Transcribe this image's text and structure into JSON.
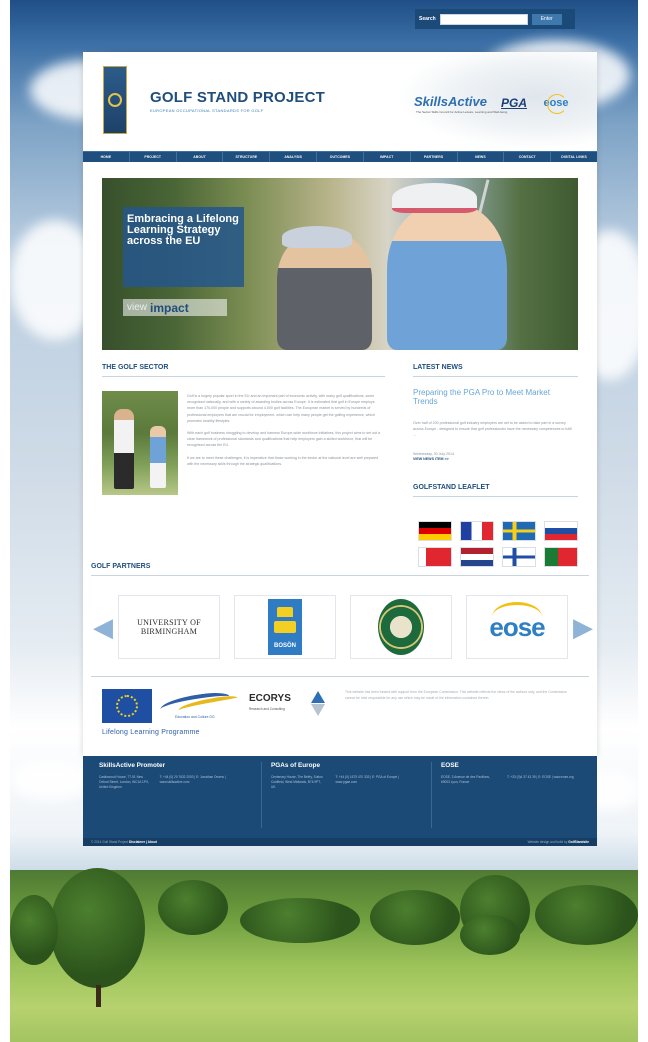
{
  "search": {
    "label": "Search",
    "placeholder": "",
    "button": "Enter"
  },
  "header": {
    "title": "GOLF STAND PROJECT",
    "subtitle": "EUROPEAN OCCUPATIONAL STANDARDS FOR GOLF",
    "logos": {
      "skillsactive": "SkillsActive",
      "skillsactive_sub": "The Sector Skills Council for Active Leisure, Learning and Well-being",
      "pga": "PGA",
      "eose": "eose"
    }
  },
  "nav": [
    "HOME",
    "PROJECT",
    "ABOUT",
    "STRUCTURE",
    "ANALYSIS",
    "OUTCOMES",
    "IMPACT",
    "PARTNERS",
    "NEWS",
    "CONTACT",
    "DIGITAL LINKS"
  ],
  "hero": {
    "caption_line1": "Embracing a Lifelong",
    "caption_line2": "Learning Strategy",
    "caption_line3": "across the EU",
    "button_view": "view",
    "button_impact": "impact"
  },
  "golf_sector": {
    "title": "THE GOLF SECTOR",
    "paragraphs": [
      "Golf is a hugely popular sport in the EU and an important part of economic activity, with many golf qualifications, some recognised nationally, and with a variety of awarding bodies across Europe. It is estimated that golf in Europe employs more than 170,000 people and supports around 4,000 golf facilities. The European market is served by hundreds of professional employers that are crucial for employment, which can help many people get the golfing experience, which promotes healthy lifestyles.",
      "With each golf business struggling to develop and harness Europe-wide workforce initiatives, this project aims to set out a clear framework of professional standards and qualifications that help employers gain a skilled workforce, that will be recognised across the EU.",
      "If we are to meet these challenges, it is imperative that those working in the sector at the national level are well prepared with the necessary skills through the strategic qualifications."
    ]
  },
  "latest_news": {
    "title": "LATEST NEWS",
    "headline": "Preparing the PGA Pro to Meet Market Trends",
    "body": "Over half of 200 professional golf industry employers are set to be asked to take part in a survey across Europe - designed to ensure that golf professionals have the necessary competences to fulfil ...",
    "date": "Wednesday, 30 July 2014",
    "link": "VIEW NEWS ITEM >>"
  },
  "leaflet": {
    "title": "GOLFSTAND LEAFLET"
  },
  "partners": {
    "title": "GOLF PARTNERS",
    "uob_line1": "UNIVERSITY OF",
    "uob_line2": "BIRMINGHAM",
    "boson": "BOSÖN",
    "badge": "EGCOA",
    "eose": "eose"
  },
  "funding": {
    "llp_small": "Education and Culture DG",
    "llp": "Lifelong Learning Programme",
    "ecorys": "ECORYS",
    "ecorys_sub": "Research and Consulting",
    "disclaimer": "This website has been funded with support from the European Commission. This website reflects the views of the authors only, and the Commission cannot be held responsible for any use which may be made of the information contained therein."
  },
  "footer": {
    "col1": {
      "title": "SkillsActive Promoter",
      "address": "Castlewood House, 77-91 New Oxford Street, London, WC1A 1PX, United Kingdom",
      "contact": "T: +44 (0) 20 7632 2000 | E: Jonathan Owens | www.skillsactive.com"
    },
    "col2": {
      "title": "PGAs of Europe",
      "address": "Centenary House, The Belfry, Sutton Coldfield, West Midlands, B76 9PT, UK",
      "contact": "T: +44 (0) 1675 470 333 | E: PGA of Europe | www.pgae.com"
    },
    "col3": {
      "title": "EOSE",
      "address": "EOSE, 3 Avenue de des Pavillons, 69003 Lyon, France",
      "contact": "T: +33 (0)4 37 43 39 | E: EOSE | www.eose.org"
    },
    "bottom_left": "© 2014 Golf Stand Project",
    "bottom_left_link": "Disclaimer | About",
    "bottom_right": "Website design and build by",
    "bottom_right_link": "GolfStandsite"
  }
}
